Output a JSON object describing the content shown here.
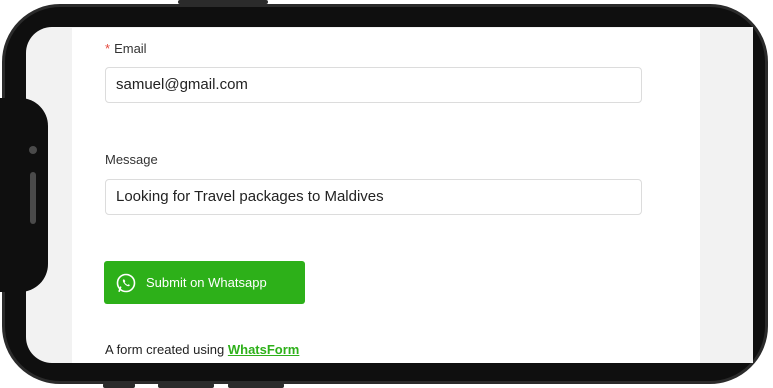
{
  "form": {
    "email": {
      "required_mark": "*",
      "label": "Email",
      "value": "samuel@gmail.com"
    },
    "message": {
      "label": "Message",
      "value": "Looking for Travel packages to Maldives"
    },
    "submit": {
      "label": "Submit on Whatsapp",
      "icon": "whatsapp-icon"
    },
    "footer": {
      "text": "A form created using",
      "link_text": "WhatsForm"
    }
  },
  "colors": {
    "accent": "#2db019",
    "required": "#e5483d"
  }
}
